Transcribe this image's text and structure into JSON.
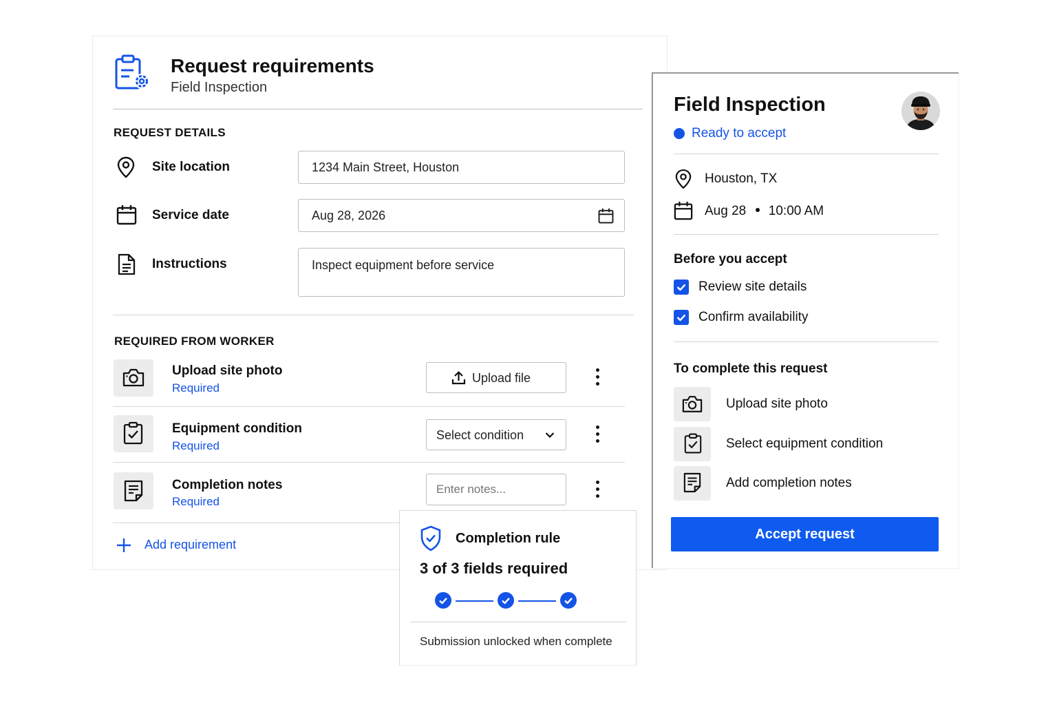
{
  "request_card": {
    "title": "Request requirements",
    "subtitle": "Field Inspection",
    "request_details_heading": "REQUEST DETAILS",
    "fields": [
      {
        "label": "Site location",
        "icon": "map-pin-icon",
        "value": "1234 Main Street, Houston"
      },
      {
        "label": "Service date",
        "icon": "calendar-icon",
        "value": "Aug 28, 2026"
      },
      {
        "label": "Instructions",
        "icon": "document-icon",
        "value": "Inspect equipment before service"
      }
    ],
    "required_heading": "REQUIRED FROM WORKER",
    "requirements": [
      {
        "title": "Upload site photo",
        "status": "Required",
        "icon": "camera-icon",
        "control": "Upload file"
      },
      {
        "title": "Equipment condition",
        "status": "Required",
        "icon": "clipboard-check-icon",
        "control": "Select condition"
      },
      {
        "title": "Completion notes",
        "status": "Required",
        "icon": "notes-icon",
        "placeholder": "Enter notes..."
      }
    ],
    "add_requirement": "Add requirement"
  },
  "completion_rule": {
    "title": "Completion rule",
    "summary": "3 of 3 fields required",
    "steps_complete": 3,
    "steps_total": 3,
    "footer": "Submission unlocked when complete"
  },
  "inspection_card": {
    "title": "Field Inspection",
    "status": "Ready to accept",
    "location": "Houston, TX",
    "date": "Aug 28",
    "time": "10:00 AM",
    "before_heading": "Before you accept",
    "checklist": [
      {
        "label": "Review site details",
        "checked": true
      },
      {
        "label": "Confirm availability",
        "checked": true
      }
    ],
    "complete_heading": "To complete this request",
    "tasks": [
      {
        "label": "Upload site photo",
        "icon": "camera-icon"
      },
      {
        "label": "Select equipment condition",
        "icon": "clipboard-check-icon"
      },
      {
        "label": "Add completion notes",
        "icon": "notes-icon"
      }
    ],
    "accept_button": "Accept request"
  },
  "colors": {
    "accent": "#1453e6",
    "button": "#0f5bf0",
    "icon_box": "#ececec",
    "border": "#bdbdbd"
  }
}
